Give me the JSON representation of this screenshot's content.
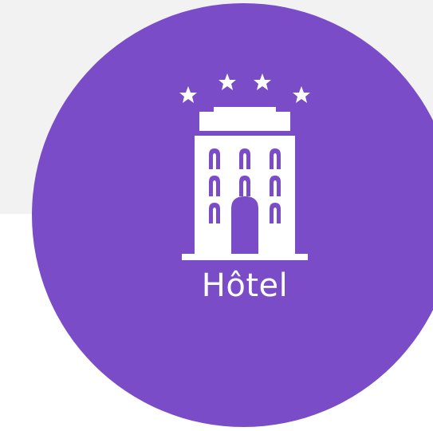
{
  "tile": {
    "label": "Hôtel",
    "icon": "hotel-icon",
    "circle_color": "#7b4cc8",
    "panel_color": "#f2f2f2",
    "icon_color": "#ffffff"
  }
}
